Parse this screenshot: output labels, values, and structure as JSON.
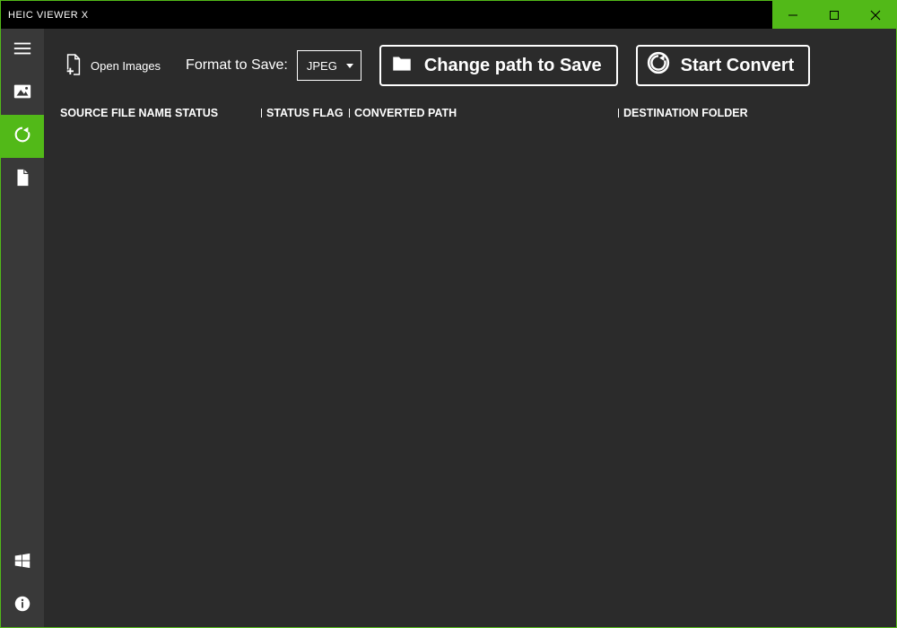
{
  "title": "HEIC VIEWER X",
  "sidebar": {
    "items": [
      {
        "name": "menu-icon"
      },
      {
        "name": "image-icon"
      },
      {
        "name": "convert-icon"
      },
      {
        "name": "file-icon"
      }
    ],
    "bottom": [
      {
        "name": "windows-icon"
      },
      {
        "name": "info-icon"
      }
    ],
    "active_index": 2
  },
  "toolbar": {
    "open_images_label": "Open Images",
    "format_label": "Format to Save:",
    "format_selected": "JPEG",
    "change_path_label": "Change path to Save",
    "start_convert_label": "Start Convert"
  },
  "columns": {
    "source": "SOURCE FILE NAME",
    "status": "STATUS",
    "flag": "STATUS FLAG",
    "converted": "CONVERTED PATH",
    "destination": "DESTINATION FOLDER"
  },
  "colors": {
    "accent": "#52b918",
    "bg": "#2b2b2b",
    "sidebar": "#393939"
  }
}
